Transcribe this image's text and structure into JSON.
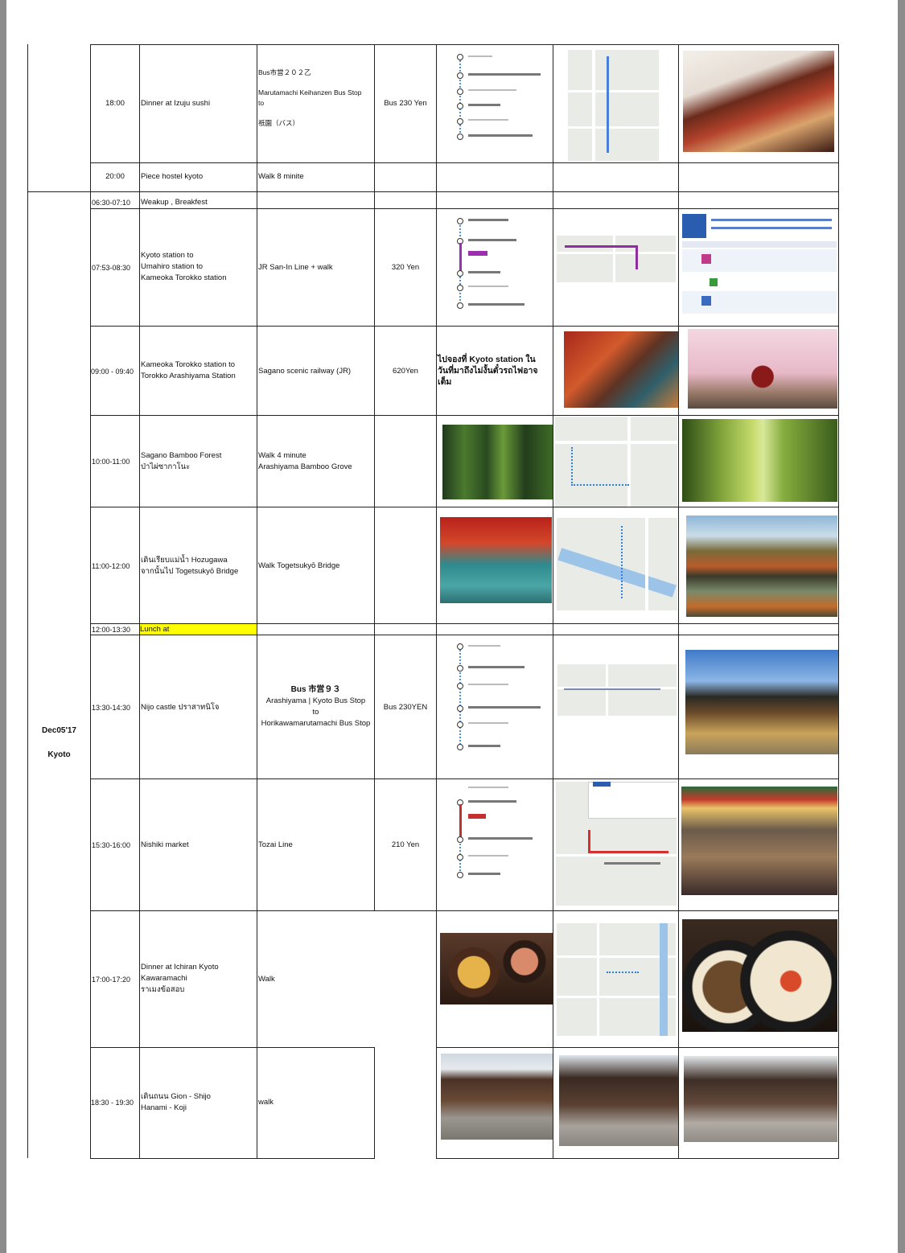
{
  "day": {
    "date": "Dec05'17",
    "city": "Kyoto"
  },
  "rows": [
    {
      "time": "18:00",
      "activity": "Dinner at Izuju sushi",
      "transport": "Bus市営２０２乙\n\nMarutamachi Keihanzen Bus Stop\nto\n\n祇園（バス）",
      "cost": "Bus 230 Yen"
    },
    {
      "time": "20:00",
      "activity": "Piece hostel kyoto",
      "transport": "Walk 8 minite",
      "cost": ""
    },
    {
      "time": "06:30-07:10",
      "activity": "Weakup , Breakfest",
      "transport": "",
      "cost": ""
    },
    {
      "time": "07:53-08:30",
      "activity": "Kyoto station to\nUmahiro station to\nKameoka Torokko station",
      "transport": "JR San-In Line + walk",
      "cost": "320 Yen"
    },
    {
      "time": "09:00 - 09:40",
      "activity": "Kameoka Torokko station to\nTorokko Arashiyama Station",
      "transport": "Sagano scenic railway (JR)",
      "cost": "620Yen",
      "note": "ไปจองที่ Kyoto station ใน\nวันที่มาถึงไม่งั้นตั๋วรถไฟอาจ\nเต็ม"
    },
    {
      "time": "10:00-11:00",
      "activity": "Sagano Bamboo Forest\nป่าไผ่ซากาโนะ",
      "transport": "Walk 4 minute\nArashiyama Bamboo Grove",
      "cost": ""
    },
    {
      "time": "11:00-12:00",
      "activity": "เดินเรียบแม่น้ำ  Hozugawa\nจากนั้นไป  Togetsukyō Bridge",
      "transport": "Walk Togetsukyō Bridge",
      "cost": ""
    },
    {
      "time": "12:00-13:30",
      "activity": "Lunch at",
      "transport": "",
      "cost": ""
    },
    {
      "time": "13:30-14:30",
      "activity": "Nijo castle ปราสาทนิโจ",
      "transport_title": "Bus 市営９３",
      "transport": "Arashiyama | Kyoto Bus Stop\nto\nHorikawamarutamachi Bus Stop",
      "cost": "Bus 230YEN"
    },
    {
      "time": "15:30-16:00",
      "activity": "Nishiki market",
      "transport": "Tozai Line",
      "cost": "210 Yen"
    },
    {
      "time": "17:00-17:20",
      "activity": "Dinner at Ichiran Kyoto\nKawaramachi\nราเมงข้อสอบ",
      "transport": "Walk",
      "cost": ""
    },
    {
      "time": "18:30 - 19:30",
      "activity": "เดินถนน   Gion - Shijo\nHanami - Koji",
      "transport": "walk",
      "cost": ""
    }
  ],
  "colors": {
    "highlight": "#ffff00",
    "grid": "#222222",
    "frame": "#8c8c8c"
  }
}
